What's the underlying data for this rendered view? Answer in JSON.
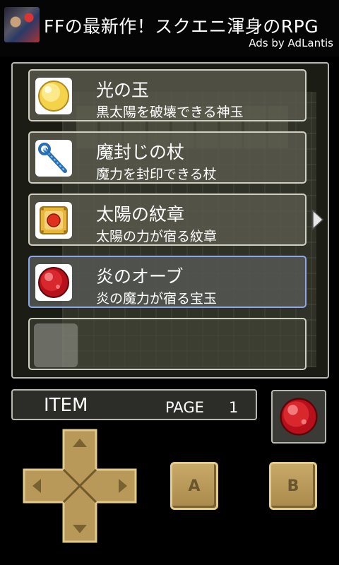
{
  "ad": {
    "title": "FFの最新作！スクエニ渾身のRPG",
    "subtitle": "Ads by AdLantis"
  },
  "items": [
    {
      "name": "光の玉",
      "description": "黒太陽を破壊できる神玉",
      "icon": "light-orb-icon",
      "selected": false
    },
    {
      "name": "魔封じの杖",
      "description": "魔力を封印できる杖",
      "icon": "magic-seal-staff-icon",
      "selected": false
    },
    {
      "name": "太陽の紋章",
      "description": "太陽の力が宿る紋章",
      "icon": "sun-crest-icon",
      "selected": false
    },
    {
      "name": "炎のオーブ",
      "description": "炎の魔力が宿る宝玉",
      "icon": "fire-orb-icon",
      "selected": true
    }
  ],
  "menu": {
    "label": "ITEM",
    "page_label": "PAGE",
    "page_number": "1"
  },
  "equipped": {
    "icon": "fire-orb-icon"
  },
  "buttons": {
    "a": "A",
    "b": "B"
  },
  "colors": {
    "selected_border": "#8fa6e8",
    "button_gold": "#c8a968"
  }
}
